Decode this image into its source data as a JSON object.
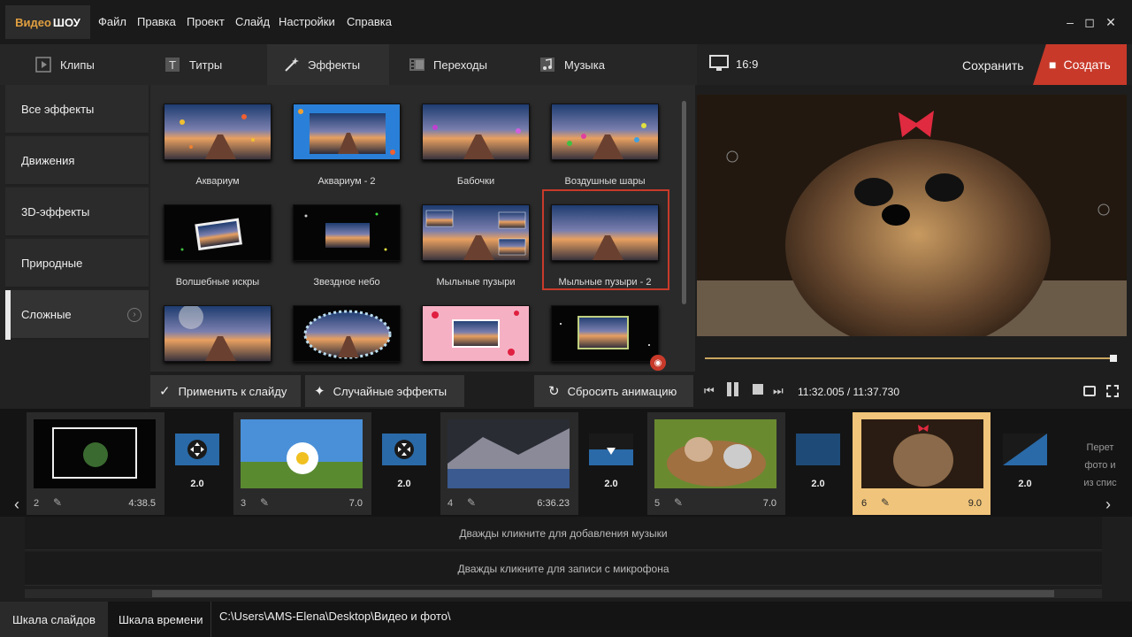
{
  "app": {
    "logo_a": "Видео",
    "logo_b": "ШОУ"
  },
  "menu": [
    "Файл",
    "Правка",
    "Проект",
    "Слайд",
    "Настройки",
    "Справка"
  ],
  "window": {
    "minimize": "‒",
    "maximize": "◻",
    "close": "✕"
  },
  "tabs": [
    {
      "label": "Клипы",
      "icon": "play-icon"
    },
    {
      "label": "Титры",
      "icon": "text-icon"
    },
    {
      "label": "Эффекты",
      "icon": "magic-wand-icon"
    },
    {
      "label": "Переходы",
      "icon": "film-icon"
    },
    {
      "label": "Музыка",
      "icon": "music-icon"
    }
  ],
  "categories": [
    "Все эффекты",
    "Движения",
    "3D-эффекты",
    "Природные",
    "Сложные"
  ],
  "effects": [
    "Аквариум",
    "Аквариум - 2",
    "Бабочки",
    "Воздушные шары",
    "Волшебные искры",
    "Звездное небо",
    "Мыльные пузыри",
    "Мыльные пузыри - 2"
  ],
  "buttons": {
    "apply": "Применить к слайду",
    "random": "Случайные эффекты",
    "reset": "Сбросить анимацию"
  },
  "preview": {
    "aspect": "16:9",
    "save": "Сохранить",
    "create": "Создать",
    "time_current": "11:32.005",
    "time_sep": " / ",
    "time_total": "11:37.730",
    "progress": 0.99
  },
  "slides": [
    {
      "num": "2",
      "dur": "4:38.5"
    },
    {
      "num": "3",
      "dur": "7.0"
    },
    {
      "num": "4",
      "dur": "6:36.23"
    },
    {
      "num": "5",
      "dur": "7.0"
    },
    {
      "num": "6",
      "dur": "9.0"
    }
  ],
  "transitions": [
    "2.0",
    "2.0",
    "2.0",
    "2.0",
    "2.0"
  ],
  "hint": {
    "line1": "Перет",
    "line2": "фото и",
    "line3": "из спис"
  },
  "tracks": {
    "music": "Дважды кликните для добавления музыки",
    "mic": "Дважды кликните для записи с микрофона"
  },
  "status": {
    "slides_tab": "Шкала слайдов",
    "timeline_tab": "Шкала времени",
    "path": "C:\\Users\\AMS-Elena\\Desktop\\Видео и фото\\"
  },
  "colors": {
    "accent_red": "#c8392a",
    "active_slide": "#f0c47a",
    "progress": "#c9a660"
  }
}
